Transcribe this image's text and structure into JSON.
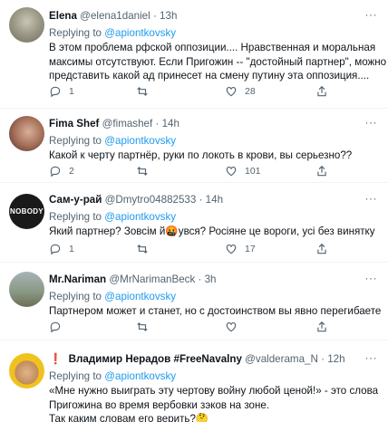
{
  "tweets": [
    {
      "name": "Elena",
      "handle": "@elena1daniel",
      "time": "13h",
      "reply_prefix": "Replying to",
      "reply_to": "@apiontkovsky",
      "lines": [
        "В этом проблема рфской оппозиции.... Нравственная и моральная",
        "максимы отсутствуют. Если Пригожин -- \"достойный партнер\", можно",
        "представить какой ад принесет на смену путину эта оппозиция...."
      ],
      "replies": "1",
      "retweets": "",
      "likes": "28"
    },
    {
      "name": "Fima Shef",
      "handle": "@fimashef",
      "time": "14h",
      "reply_prefix": "Replying to",
      "reply_to": "@apiontkovsky",
      "lines": [
        "Какой к черту партнёр, руки по локоть в крови, вы серьезно??"
      ],
      "replies": "2",
      "retweets": "",
      "likes": "101"
    },
    {
      "name": "Сам-у-рай",
      "handle": "@Dmytro04882533",
      "time": "14h",
      "avatar_text": "NOBODY",
      "reply_prefix": "Replying to",
      "reply_to": "@apiontkovsky",
      "lines": [
        "Який партнер? Зовсім й🤬увся? Росіяне це вороги, усі без винятку"
      ],
      "replies": "1",
      "retweets": "",
      "likes": "17"
    },
    {
      "name": "Mr.Nariman",
      "handle": "@MrNarimanBeck",
      "time": "3h",
      "reply_prefix": "Replying to",
      "reply_to": "@apiontkovsky",
      "lines": [
        "Партнером может и станет, но с достоинством вы явно перегибаете"
      ],
      "replies": "",
      "retweets": "",
      "likes": ""
    },
    {
      "warn_mark": "❗",
      "name": "Владимир Нерадов #FreeNavalny",
      "handle": "@valderama_N",
      "time": "12h",
      "reply_prefix": "Replying to",
      "reply_to": "@apiontkovsky",
      "lines": [
        "«Мне нужно выиграть эту чертову войну любой ценой!» - это слова",
        "Пригожина во время вербовки зэков на зоне.",
        "Так каким словам его верить?🤔"
      ],
      "replies": "",
      "retweets": "",
      "likes": ""
    }
  ],
  "separator": "·",
  "more_glyph": "···",
  "icons": [
    "reply-icon",
    "retweet-icon",
    "like-icon",
    "share-icon",
    "more-icon"
  ],
  "colors": {
    "link": "#1d9bf0",
    "muted": "#536471",
    "text": "#0f1419",
    "divider": "#eff3f4"
  }
}
